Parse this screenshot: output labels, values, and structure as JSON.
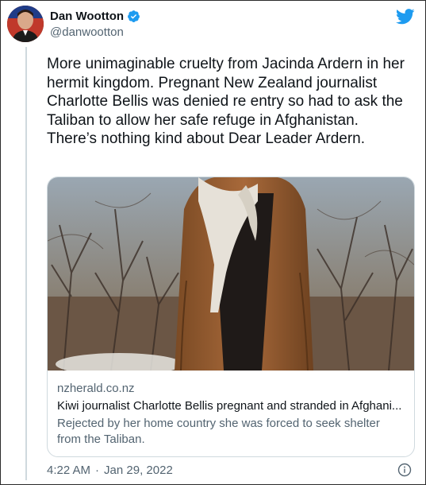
{
  "author": {
    "display_name": "Dan Wootton",
    "handle": "@danwootton",
    "verified_icon": "verified-badge-icon",
    "avatar_icon": "profile-avatar"
  },
  "brand": {
    "logo_icon": "twitter-bird-icon",
    "color": "#1d9bf0"
  },
  "tweet": {
    "text": "More unimaginable cruelty from Jacinda Ardern in her hermit kingdom. Pregnant New Zealand journalist Charlotte Bellis was denied re entry so had to ask the Taliban to allow her safe refuge in Afghanistan.\nThere’s nothing kind about Dear Leader Ardern."
  },
  "card": {
    "domain": "nzherald.co.nz",
    "title": "Kiwi journalist Charlotte Bellis pregnant and stranded in Afghani...",
    "description": "Rejected by her home country she was forced to seek shelter from the Taliban.",
    "image_icon": "article-photo"
  },
  "footer": {
    "time": "4:22 AM",
    "separator": "·",
    "date": "Jan 29, 2022",
    "info_icon": "info-icon"
  }
}
